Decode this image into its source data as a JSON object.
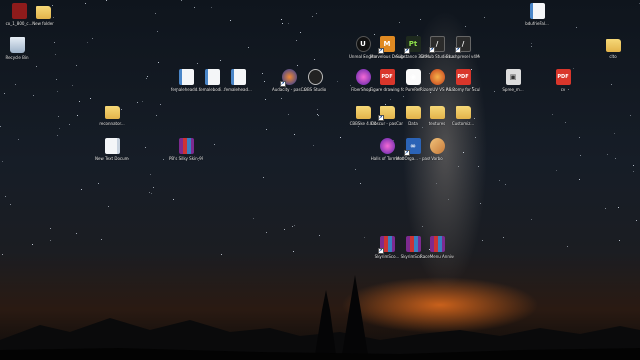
{
  "desktop": {
    "icons": [
      {
        "id": "c",
        "label": "co_1_800_c...",
        "kind": "red"
      },
      {
        "id": "nf",
        "label": "New folder",
        "kind": "folder"
      },
      {
        "id": "rb",
        "label": "Recycle Bin",
        "kind": "recycle"
      },
      {
        "id": "rec",
        "label": "reconnator...",
        "kind": "folder"
      },
      {
        "id": "ntd",
        "label": "New Text Document....",
        "kind": "doc"
      },
      {
        "id": "fem1",
        "label": "femaleheadd...",
        "kind": "docblue"
      },
      {
        "id": "fem2",
        "label": "femalebodi...",
        "kind": "docblue"
      },
      {
        "id": "fem3",
        "label": "femalehead...",
        "kind": "docblue"
      },
      {
        "id": "sky1",
        "label": "PB's Silky Skin-9938-1-...",
        "kind": "rar"
      },
      {
        "id": "aud",
        "label": "Audacity - pasCar",
        "kind": "audacity",
        "shortcut": true
      },
      {
        "id": "obs",
        "label": "OBS Studio",
        "kind": "obs"
      },
      {
        "id": "ue",
        "label": "Unreal Engine",
        "kind": "black",
        "glyph": "U"
      },
      {
        "id": "mar",
        "label": "Marvelous Designer...",
        "kind": "orange",
        "glyph": "M",
        "shortcut": true
      },
      {
        "id": "sp",
        "label": "Substance 3D Painter 2023",
        "kind": "green",
        "glyph": "Pt",
        "shortcut": true
      },
      {
        "id": "gs",
        "label": "GitHub Studio Lab mmr...",
        "kind": "dark",
        "glyph": "/",
        "shortcut": true
      },
      {
        "id": "bp",
        "label": "Brushpresel v4Mod...",
        "kind": "dark",
        "glyph": "/",
        "shortcut": true
      },
      {
        "id": "blue",
        "label": "bdufrieFal...",
        "kind": "docblue"
      },
      {
        "id": "fib",
        "label": "FiberShop...",
        "kind": "purple"
      },
      {
        "id": "fig",
        "label": "Figure drawing fo...",
        "kind": "pdf",
        "glyph": "PDF"
      },
      {
        "id": "pure",
        "label": "PureRef",
        "kind": "white",
        "glyph": "◉"
      },
      {
        "id": "rs",
        "label": "RizomUV VS RS 2021.1",
        "kind": "fire"
      },
      {
        "id": "ana",
        "label": "Anatomy for Sculptors...",
        "kind": "pdf",
        "glyph": "PDF"
      },
      {
        "id": "spree",
        "label": "Spree_m...",
        "kind": "cube",
        "glyph": "▣"
      },
      {
        "id": "cv",
        "label": "cv",
        "kind": "pdf",
        "glyph": "PDF"
      },
      {
        "id": "cbbr",
        "label": "CBBSke 4.8.4",
        "kind": "folder"
      },
      {
        "id": "obs2",
        "label": "Obscur - pasCar",
        "kind": "folder",
        "shortcut": true
      },
      {
        "id": "data",
        "label": "Data",
        "kind": "folder"
      },
      {
        "id": "tex",
        "label": "textures",
        "kind": "folder"
      },
      {
        "id": "cust",
        "label": "Customiz...",
        "kind": "folder"
      },
      {
        "id": "hof",
        "label": "Halls of Torment",
        "kind": "purple"
      },
      {
        "id": "mod",
        "label": "ModOrga... - pasCar",
        "kind": "blue",
        "glyph": "∞",
        "shortcut": true
      },
      {
        "id": "brush",
        "label": "Varbo",
        "kind": "brush"
      },
      {
        "id": "sky2",
        "label": "SkyrimSco...",
        "kind": "rar",
        "shortcut": true
      },
      {
        "id": "sky3",
        "label": "SkyrimSco...",
        "kind": "rar"
      },
      {
        "id": "race",
        "label": "RaceMenu Anniversary...",
        "kind": "rar"
      },
      {
        "id": "clo",
        "label": "clto",
        "kind": "folder"
      }
    ]
  }
}
